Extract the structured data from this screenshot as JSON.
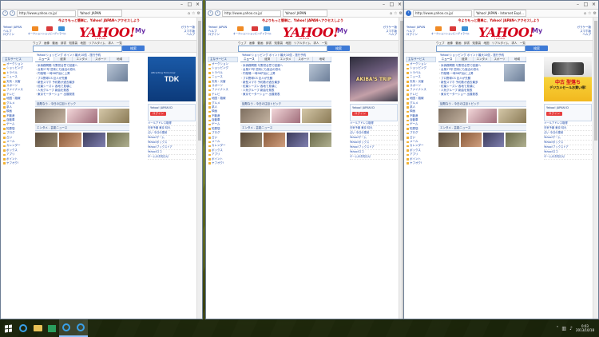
{
  "taskbar": {
    "apps": [
      "ie-icon",
      "explorer-icon",
      "store-icon",
      "ie-icon",
      "ie-icon"
    ],
    "clock_time": "0:03",
    "clock_date": "2013/10/18"
  },
  "windows": [
    {
      "url": "http://www.yahoo.co.jp/",
      "tab": "Yahoo! JAPAN",
      "ad_text": "TDK",
      "ad_small": "Attracting Tomorrow"
    },
    {
      "url": "http://www.yahoo.co.jp/",
      "tab": "Yahoo! JAPAN",
      "ad_text": "AKIBA'S TRIP",
      "ad_small": ""
    },
    {
      "url": "http://www.yahoo.co.jp/",
      "tab": "Yahoo! JAPAN - Internet Expl...",
      "ad_text": "中古 型落ち",
      "ad_small": "デジカメセールお買い得!"
    }
  ],
  "common": {
    "banner": "今よりもっと簡単に、Yahoo! JAPANへアクセスしよう",
    "logo": "YAHOO!",
    "logo_sub": "JAPAN",
    "my": "My",
    "left_links": [
      "Yahoo! JAPAN",
      "ヘルプ",
      "ログイン"
    ],
    "right_links": [
      "ガラケー版",
      "スマホ版",
      "ヘルプ"
    ],
    "services": [
      {
        "label": "オークション",
        "color": "#f08a24"
      },
      {
        "label": "ショッピング",
        "color": "#d93a3a"
      },
      {
        "label": "トラベル",
        "color": "#3b8fd4"
      }
    ],
    "search_tabs": "ウェブ　画像　動画　辞書　知恵袋　地図　リアルタイム　求人　一覧",
    "search_button": "検索",
    "pickup": "Yahoo!ショッピング ポイント最大10倍 - 旅行予約",
    "sidebar_head": "主なサービス",
    "sidebar_items": [
      "オークション",
      "ショッピング",
      "トラベル",
      "ニュース",
      "天気・災害",
      "スポーツ",
      "ファイナンス",
      "テレビ",
      "地図・路線",
      "グルメ",
      "求人",
      "映画",
      "不動産",
      "自動車",
      "ゲーム",
      "知恵袋",
      "ブログ",
      "占い",
      "メール",
      "カレンダー",
      "ボックス",
      "アプリ",
      "ポイント",
      "ヤフオク!"
    ],
    "news_tabs": [
      "ニュース",
      "経済",
      "エンタメ",
      "スポーツ",
      "地域"
    ],
    "headlines": [
      "米債務問題 与野党合意で回避へ",
      "台風27号 週末にも接近の恐れ",
      "円相場 一時98円台に上昇",
      "プロ野球CS 巨人が先勝",
      "新型スマホ 予約数が過去最多",
      "紅葉シーズン 各地で見頃に",
      "人気グループ 新曲を発表",
      "東京モーターショー 出展発表"
    ],
    "section_bar_1": "話題なう - 今日の注目トピック",
    "section_bar_2": "エンタメ - 芸能ニュース",
    "login_title": "Yahoo! JAPAN ID",
    "login_button": "ログイン",
    "right_list": [
      "メールアドレス取得",
      "天気予報 東京 晴れ",
      "占い 今日の運勢",
      "Yahoo!ゲーム",
      "Yahoo!ボックス",
      "Yahoo!ブックストア",
      "Yahoo!ロコ",
      "ゲームのお知らせ"
    ]
  }
}
